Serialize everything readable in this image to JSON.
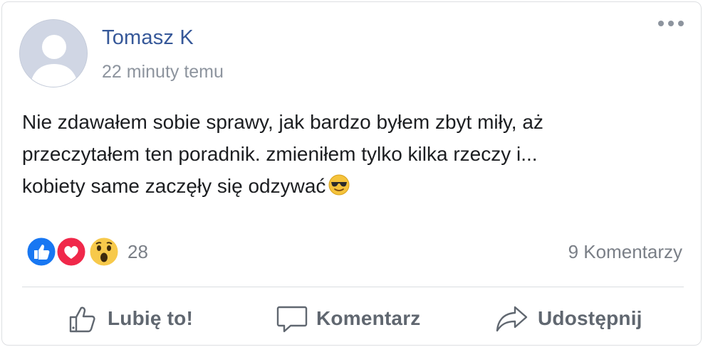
{
  "post": {
    "author": "Tomasz K",
    "timestamp": "22 minuty temu",
    "text_line1": "Nie zdawałem sobie sprawy, jak bardzo byłem zbyt miły, aż",
    "text_line2": "przeczytałem ten poradnik. zmieniłem tylko kilka rzeczy i...",
    "text_line3": "kobiety same zaczęły się odzywać",
    "text_emoji": "smiling-face-with-sunglasses"
  },
  "reactions": {
    "icons": [
      "like-reaction",
      "love-reaction",
      "wow-reaction"
    ],
    "count": "28",
    "comments": "9 Komentarzy"
  },
  "actions": {
    "like_label": "Lubię to!",
    "comment_label": "Komentarz",
    "share_label": "Udostępnij"
  },
  "colors": {
    "author": "#365899",
    "muted": "#8d949e",
    "like_blue": "#1877f2",
    "love_red": "#f0284a",
    "wow_yellow": "#f7c94b"
  }
}
